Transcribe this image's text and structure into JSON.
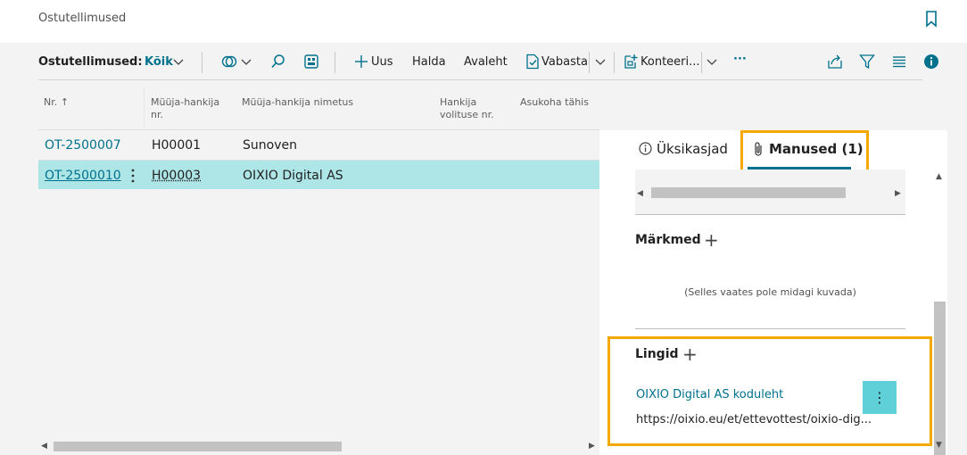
{
  "header": {
    "title": "Ostutellimused"
  },
  "toolbar": {
    "view_label": "Ostutellimused:",
    "filter_value": "Kõik",
    "new_label": "Uus",
    "manage_label": "Halda",
    "home_label": "Avaleht",
    "release_label": "Vabasta",
    "container_label": "Konteeri...",
    "more_label": "···"
  },
  "table": {
    "columns": [
      {
        "line1": "",
        "line2": "Nr. ↑"
      },
      {
        "line1": "Müüja-hankija",
        "line2": "nr."
      },
      {
        "line1": "",
        "line2": "Müüja-hankija nimetus"
      },
      {
        "line1": "Hankija",
        "line2": "volituse nr."
      },
      {
        "line1": "",
        "line2": "Asukoha tähis"
      }
    ],
    "rows": [
      {
        "no": "OT-2500007",
        "vendor_no": "H00001",
        "vendor_name": "Sunoven"
      },
      {
        "no": "OT-2500010",
        "vendor_no": "H00003",
        "vendor_name": "OIXIO Digital AS"
      }
    ]
  },
  "factbox": {
    "tabs": [
      {
        "label": "Üksikasjad"
      },
      {
        "label": "Manused (1)"
      }
    ],
    "notes": {
      "title": "Märkmed",
      "empty": "(Selles vaates pole midagi kuvada)"
    },
    "links": {
      "title": "Lingid",
      "items": [
        {
          "name": "OIXIO Digital AS koduleht",
          "url": "https://oixio.eu/et/ettevottest/oixio-dig..."
        }
      ]
    }
  },
  "colors": {
    "accent": "#00718c",
    "highlight": "#f5a800",
    "selected_row": "#aee6e8",
    "button": "#5fd0d8"
  }
}
